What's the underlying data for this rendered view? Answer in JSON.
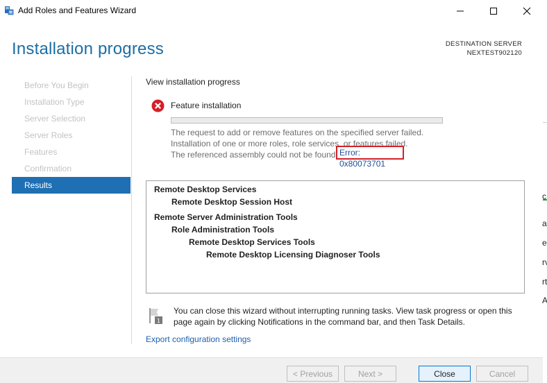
{
  "window": {
    "title": "Add Roles and Features Wizard",
    "icons": {
      "app": "server-manager-icon",
      "minimize": "minimize-icon",
      "maximize": "maximize-icon",
      "close": "close-icon"
    }
  },
  "header": {
    "page_title": "Installation progress",
    "destination_label": "DESTINATION SERVER",
    "destination_server": "NEXTEST902120"
  },
  "nav": {
    "items": [
      {
        "label": "Before You Begin",
        "state": "disabled"
      },
      {
        "label": "Installation Type",
        "state": "disabled"
      },
      {
        "label": "Server Selection",
        "state": "disabled"
      },
      {
        "label": "Server Roles",
        "state": "disabled"
      },
      {
        "label": "Features",
        "state": "disabled"
      },
      {
        "label": "Confirmation",
        "state": "disabled"
      },
      {
        "label": "Results",
        "state": "active"
      }
    ]
  },
  "content": {
    "section_label": "View installation progress",
    "status_icon": "error-icon",
    "feature_label": "Feature installation",
    "progress_fraction": 0.0,
    "messages": [
      "The request to add or remove features on the specified server failed.",
      "Installation of one or more roles, role services, or features failed.",
      "The referenced assembly could not be found."
    ],
    "error_code": "Error: 0x80073701",
    "results": [
      "Remote Desktop Services",
      "Remote Desktop Session Host",
      "Remote Server Administration Tools",
      "Role Administration Tools",
      "Remote Desktop Services Tools",
      "Remote Desktop Licensing Diagnoser Tools"
    ],
    "info_icon": "flag-info-icon",
    "info_text": "You can close this wizard without interrupting running tasks. View task progress or open this page again by clicking Notifications in the command bar, and then Task Details.",
    "export_link": "Export configuration settings"
  },
  "footer": {
    "previous": "< Previous",
    "next": "Next >",
    "close": "Close",
    "cancel": "Cancel"
  },
  "background_window": {
    "chars": [
      "c",
      "ar",
      "e",
      "rv",
      "rt",
      "A"
    ]
  },
  "colors": {
    "accent": "#1e6fb4",
    "title_blue": "#1c6ea4",
    "error_red": "#d42027",
    "link": "#1f5fb0"
  }
}
